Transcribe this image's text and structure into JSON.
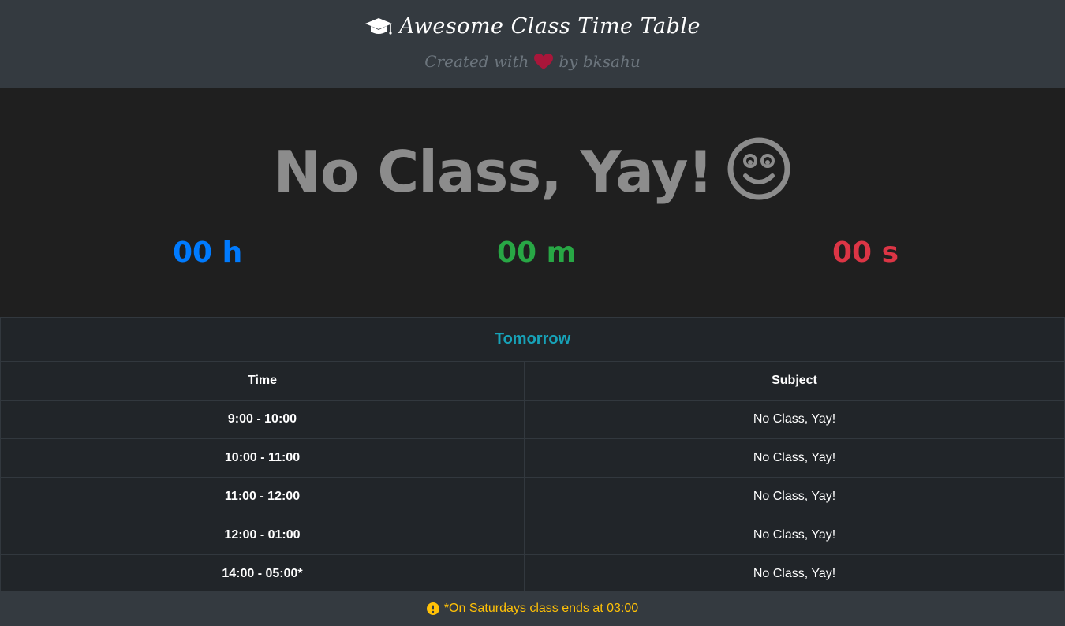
{
  "header": {
    "title": "Awesome Class Time Table",
    "subtitle_prefix": "Created with",
    "subtitle_suffix": "by bksahu",
    "icons": {
      "title_icon": "graduation-cap-icon",
      "heart_icon": "heart-icon"
    },
    "colors": {
      "heart": "#a8163a",
      "subtitle": "#6c757d"
    }
  },
  "hero": {
    "message": "No Class, Yay!",
    "icon": "smile-icon",
    "countdown": {
      "hours": "00 h",
      "minutes": "00 m",
      "seconds": "00 s"
    },
    "colors": {
      "hours": "#007bff",
      "minutes": "#28a745",
      "seconds": "#dc3545"
    }
  },
  "schedule": {
    "day": "Tomorrow",
    "columns": [
      "Time",
      "Subject"
    ],
    "rows": [
      {
        "time": "9:00 - 10:00",
        "subject": "No Class, Yay!"
      },
      {
        "time": "10:00 - 11:00",
        "subject": "No Class, Yay!"
      },
      {
        "time": "11:00 - 12:00",
        "subject": "No Class, Yay!"
      },
      {
        "time": "12:00 - 01:00",
        "subject": "No Class, Yay!"
      },
      {
        "time": "14:00 - 05:00*",
        "subject": "No Class, Yay!"
      }
    ]
  },
  "footer": {
    "note": "*On Saturdays class ends at 03:00",
    "icon": "exclamation-circle-icon",
    "color": "#ffc107"
  }
}
